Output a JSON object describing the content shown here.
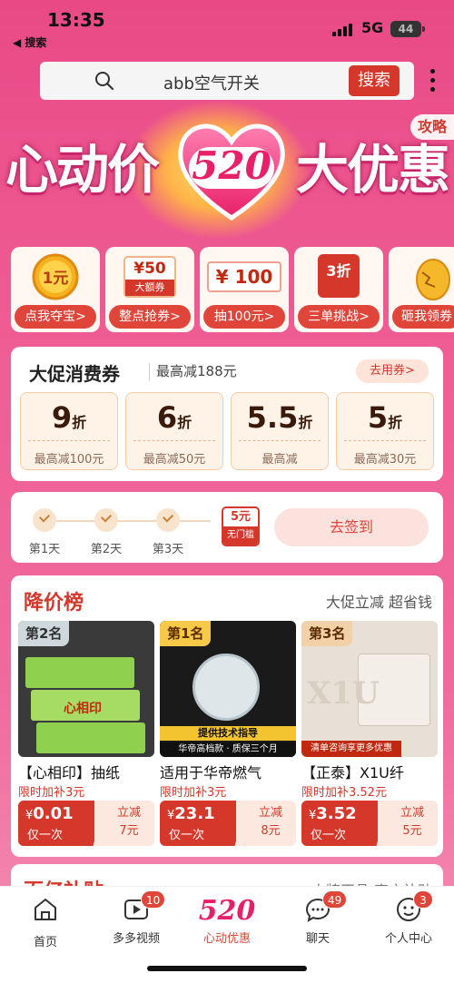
{
  "status_bar": {
    "time": "13:35",
    "back_app": "◀ 搜索",
    "network": "5G",
    "battery": "44"
  },
  "search": {
    "value": "abb空气开关",
    "button_label": "搜索"
  },
  "banner": {
    "left_text": "心动价",
    "number": "520",
    "right_text": "大优惠",
    "strategy_label": "攻略"
  },
  "quick_entries": [
    {
      "icon_text": "1元",
      "label": "点我夺宝>"
    },
    {
      "icon_text": "¥50",
      "icon_sub": "大额券",
      "label": "整点抢券>"
    },
    {
      "icon_text": "¥ 100",
      "label": "抽100元>"
    },
    {
      "icon_text": "3折",
      "label": "三单挑战>"
    },
    {
      "icon_text": "",
      "label": "砸我领券"
    }
  ],
  "coupons": {
    "title": "大促消费券",
    "subtitle": "最高减188元",
    "use_label": "去用券>",
    "items": [
      {
        "discount": "9",
        "unit": "折",
        "max": "最高减100元"
      },
      {
        "discount": "6",
        "unit": "折",
        "max": "最高减50元"
      },
      {
        "discount": "5.5",
        "unit": "折",
        "max": "最高减"
      },
      {
        "discount": "5",
        "unit": "折",
        "max": "最高减30元"
      }
    ]
  },
  "checkin": {
    "days": [
      "第1天",
      "第2天",
      "第3天"
    ],
    "reward_amount": "5元",
    "reward_label": "无门槛",
    "button_label": "去签到"
  },
  "ranking": {
    "title": "降价榜",
    "subtitle": "大促立减 超省钱",
    "products": [
      {
        "rank": "第2名",
        "name": "【心相印】抽纸",
        "subsidy": "限时加补3元",
        "price_symbol": "¥",
        "price": "0.01",
        "once": "仅一次",
        "cut_label": "立减",
        "cut_value": "7元",
        "image_text": "心相印"
      },
      {
        "rank": "第1名",
        "name": "适用于华帝燃气",
        "subsidy": "限时加补3元",
        "price_symbol": "¥",
        "price": "23.1",
        "once": "仅一次",
        "cut_label": "立减",
        "cut_value": "8元",
        "image_text": "提供技术指导",
        "image_text2": "华帝高档款 · 质保三个月"
      },
      {
        "rank": "第3名",
        "name": "【正泰】X1U纤",
        "subsidy": "限时加补3.52元",
        "price_symbol": "¥",
        "price": "3.52",
        "once": "仅一次",
        "cut_label": "立减",
        "cut_value": "5元",
        "image_text": "X1U",
        "image_text2": "清单咨询享更多优惠"
      }
    ]
  },
  "next_section": {
    "title": "百亿补贴",
    "subtitle": "大牌正品 官方补贴"
  },
  "tabbar": [
    {
      "label": "首页",
      "icon": "home-icon"
    },
    {
      "label": "多多视频",
      "icon": "video-icon",
      "badge": "10"
    },
    {
      "label": "心动优惠",
      "icon": "520-logo",
      "logo_text": "520"
    },
    {
      "label": "聊天",
      "icon": "chat-icon",
      "badge": "49"
    },
    {
      "label": "个人中心",
      "icon": "profile-icon",
      "badge": "3"
    }
  ],
  "colors": {
    "accent": "#d6372b",
    "brand_pink": "#e94a86"
  }
}
